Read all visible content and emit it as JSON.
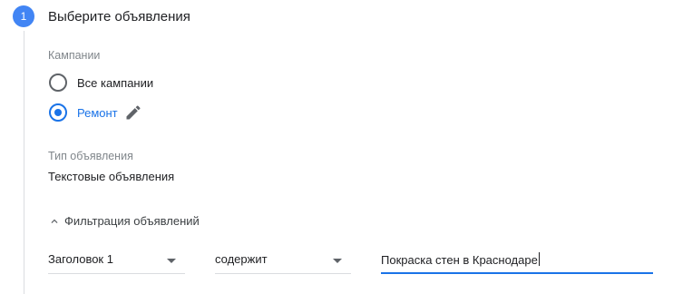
{
  "step": {
    "number": "1",
    "title": "Выберите объявления"
  },
  "campaigns": {
    "label": "Кампании",
    "options": [
      {
        "label": "Все кампании",
        "selected": false
      },
      {
        "label": "Ремонт",
        "selected": true
      }
    ],
    "edit_icon": "pencil-icon"
  },
  "ad_type": {
    "label": "Тип объявления",
    "value": "Текстовые объявления"
  },
  "filter": {
    "toggle_label": "Фильтрация объявлений",
    "toggle_icon": "chevron-up-icon",
    "field": "Заголовок 1",
    "operator": "содержит",
    "value": "Покраска стен в Краснодаре"
  },
  "colors": {
    "accent": "#1a73e8",
    "step_badge": "#4285f4",
    "muted_text": "#80868b"
  }
}
